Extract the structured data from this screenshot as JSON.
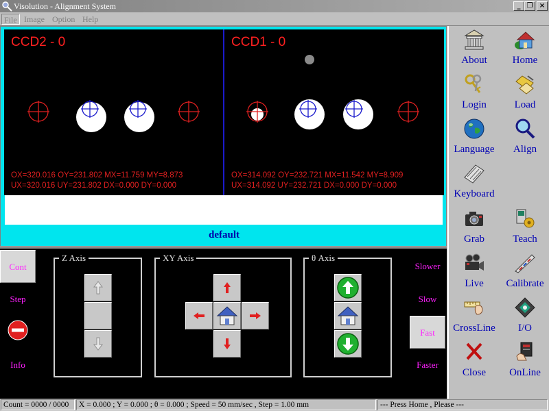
{
  "window": {
    "title": "Visolution - Alignment System"
  },
  "menu": {
    "items": [
      "File",
      "Image",
      "Option",
      "Help"
    ]
  },
  "cameras": [
    {
      "title": "CCD2 - 0",
      "line1": "OX=320.016 OY=231.802 MX=11.759 MY=8.873",
      "line2": "UX=320.016 UY=231.802 DX=0.000 DY=0.000"
    },
    {
      "title": "CCD1 - 0",
      "line1": "OX=314.092 OY=232.721 MX=11.542 MY=8.909",
      "line2": "UX=314.092 UY=232.721 DX=0.000 DY=0.000"
    }
  ],
  "recipe_name": "default",
  "toolbar": {
    "items": [
      {
        "label": "About",
        "icon": "bank-icon"
      },
      {
        "label": "Home",
        "icon": "house-icon"
      },
      {
        "label": "Login",
        "icon": "keys-icon"
      },
      {
        "label": "Load",
        "icon": "folder-icon"
      },
      {
        "label": "Language",
        "icon": "globe-icon"
      },
      {
        "label": "Align",
        "icon": "magnifier-icon"
      },
      {
        "label": "Keyboard",
        "icon": "keyboard-icon"
      },
      {
        "label": "Grab",
        "icon": "camera-icon"
      },
      {
        "label": "Teach",
        "icon": "teach-icon"
      },
      {
        "label": "Live",
        "icon": "video-camera-icon"
      },
      {
        "label": "Calibrate",
        "icon": "calibrate-icon"
      },
      {
        "label": "CrossLine",
        "icon": "ruler-hand-icon"
      },
      {
        "label": "I/O",
        "icon": "io-icon"
      },
      {
        "label": "Close",
        "icon": "x-icon"
      },
      {
        "label": "OnLine",
        "icon": "online-icon"
      }
    ]
  },
  "motion": {
    "modes": [
      "Cont",
      "Step",
      "Info"
    ],
    "speeds": [
      "Slower",
      "Slow",
      "Fast",
      "Faster"
    ],
    "groups": {
      "z": "Z  Axis",
      "xy": "XY  Axis",
      "theta": "θ   Axis"
    }
  },
  "status": {
    "count": "Count = 0000 / 0000",
    "position": "X = 0.000 ; Y = 0.000 ;  θ  = 0.000 ; Speed = 50 mm/sec , Step = 1.00 mm",
    "message": "--- Press Home , Please ---"
  },
  "colors": {
    "cyan_frame": "#00e5ee",
    "label_blue": "#0000b4",
    "mode_magenta": "#ff20ff",
    "overlay_red": "#ff2020"
  }
}
